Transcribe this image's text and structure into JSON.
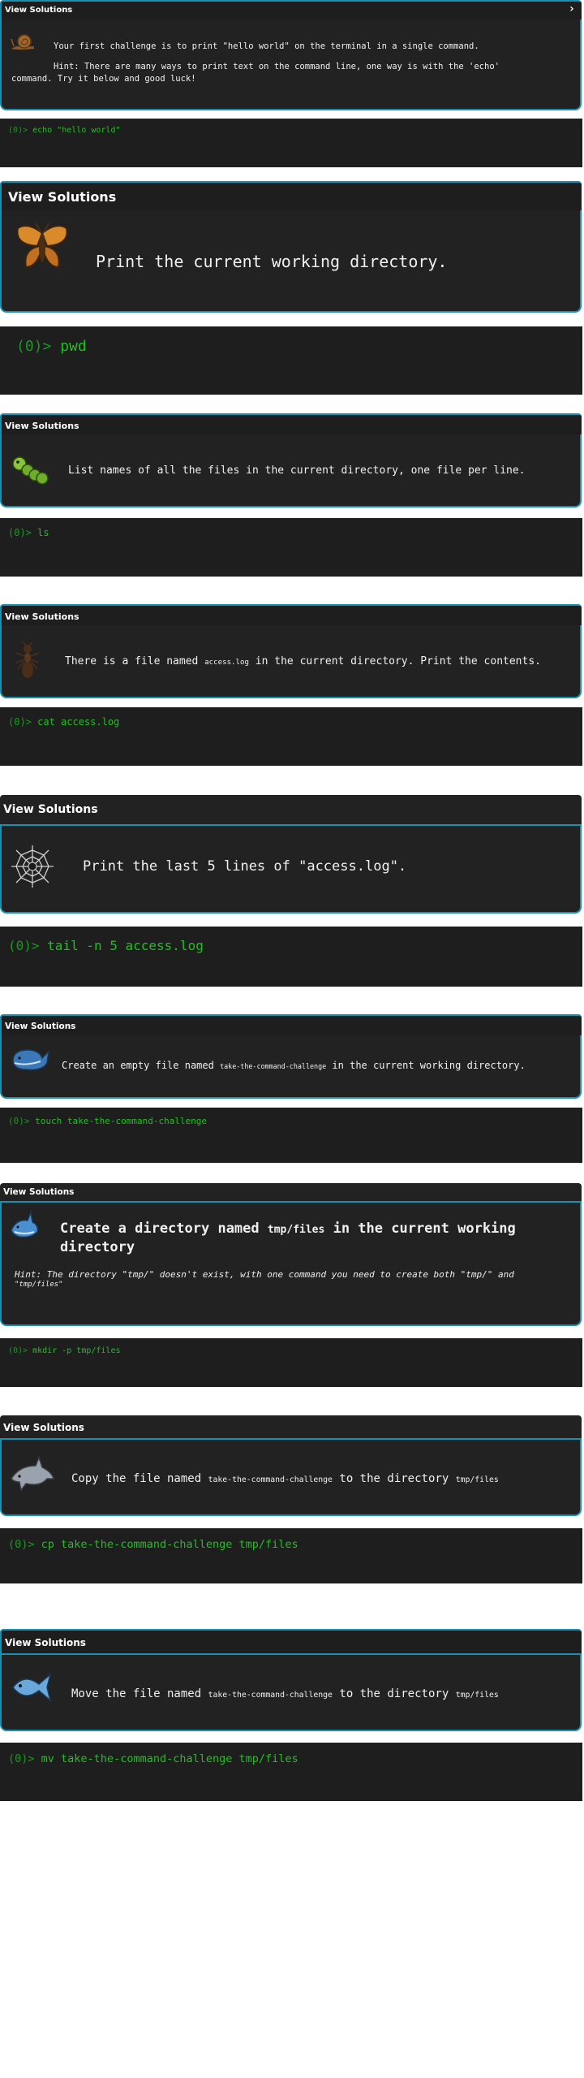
{
  "solutions_label": "View Solutions",
  "prompt_symbol": "(0)>",
  "challenges": [
    {
      "icon": "snail-icon",
      "text": "Your first challenge is to print \"hello world\" on the terminal in a single command.",
      "hint": "Hint: There are many ways to print text on the command line, one way is with the 'echo' command. Try it below and good luck!",
      "command": "echo \"hello world\""
    },
    {
      "icon": "butterfly-icon",
      "text": "Print the current working directory.",
      "command": "pwd"
    },
    {
      "icon": "caterpillar-icon",
      "text": "List names of all the files in the current directory, one file per line.",
      "command": "ls"
    },
    {
      "icon": "ant-icon",
      "text_before": "There is a file named",
      "file": "access.log",
      "text_after": "in the current directory. Print the contents.",
      "command": "cat access.log"
    },
    {
      "icon": "spider-web-icon",
      "text": "Print the last 5 lines of \"access.log\".",
      "command": "tail -n 5 access.log"
    },
    {
      "icon": "whale-icon",
      "text_before": "Create an empty file named",
      "file": "take-the-command-challenge",
      "text_after": "in the current working directory.",
      "command": "touch take-the-command-challenge"
    },
    {
      "icon": "shark-icon",
      "text_before": "Create a directory named",
      "file": "tmp/files",
      "text_after": "in the current working",
      "text_line2": "directory",
      "hint": "Hint: The directory \"tmp/\" doesn't exist, with one command you need to create both \"tmp/\" and",
      "hint_line2": "\"tmp/files\"",
      "command": "mkdir -p tmp/files"
    },
    {
      "icon": "dolphin-icon",
      "text_before": "Copy the file named",
      "file": "take-the-command-challenge",
      "text_mid": "to the directory",
      "file2": "tmp/files",
      "command": "cp take-the-command-challenge tmp/files"
    },
    {
      "icon": "fish-icon",
      "text_before": "Move the file named",
      "file": "take-the-command-challenge",
      "text_mid": "to the directory",
      "file2": "tmp/files",
      "command": "mv take-the-command-challenge tmp/files"
    }
  ],
  "colors": {
    "accent": "#1b8fb0",
    "panel": "#222222",
    "terminal": "#1e1e1e",
    "prompt": "#20c020"
  }
}
